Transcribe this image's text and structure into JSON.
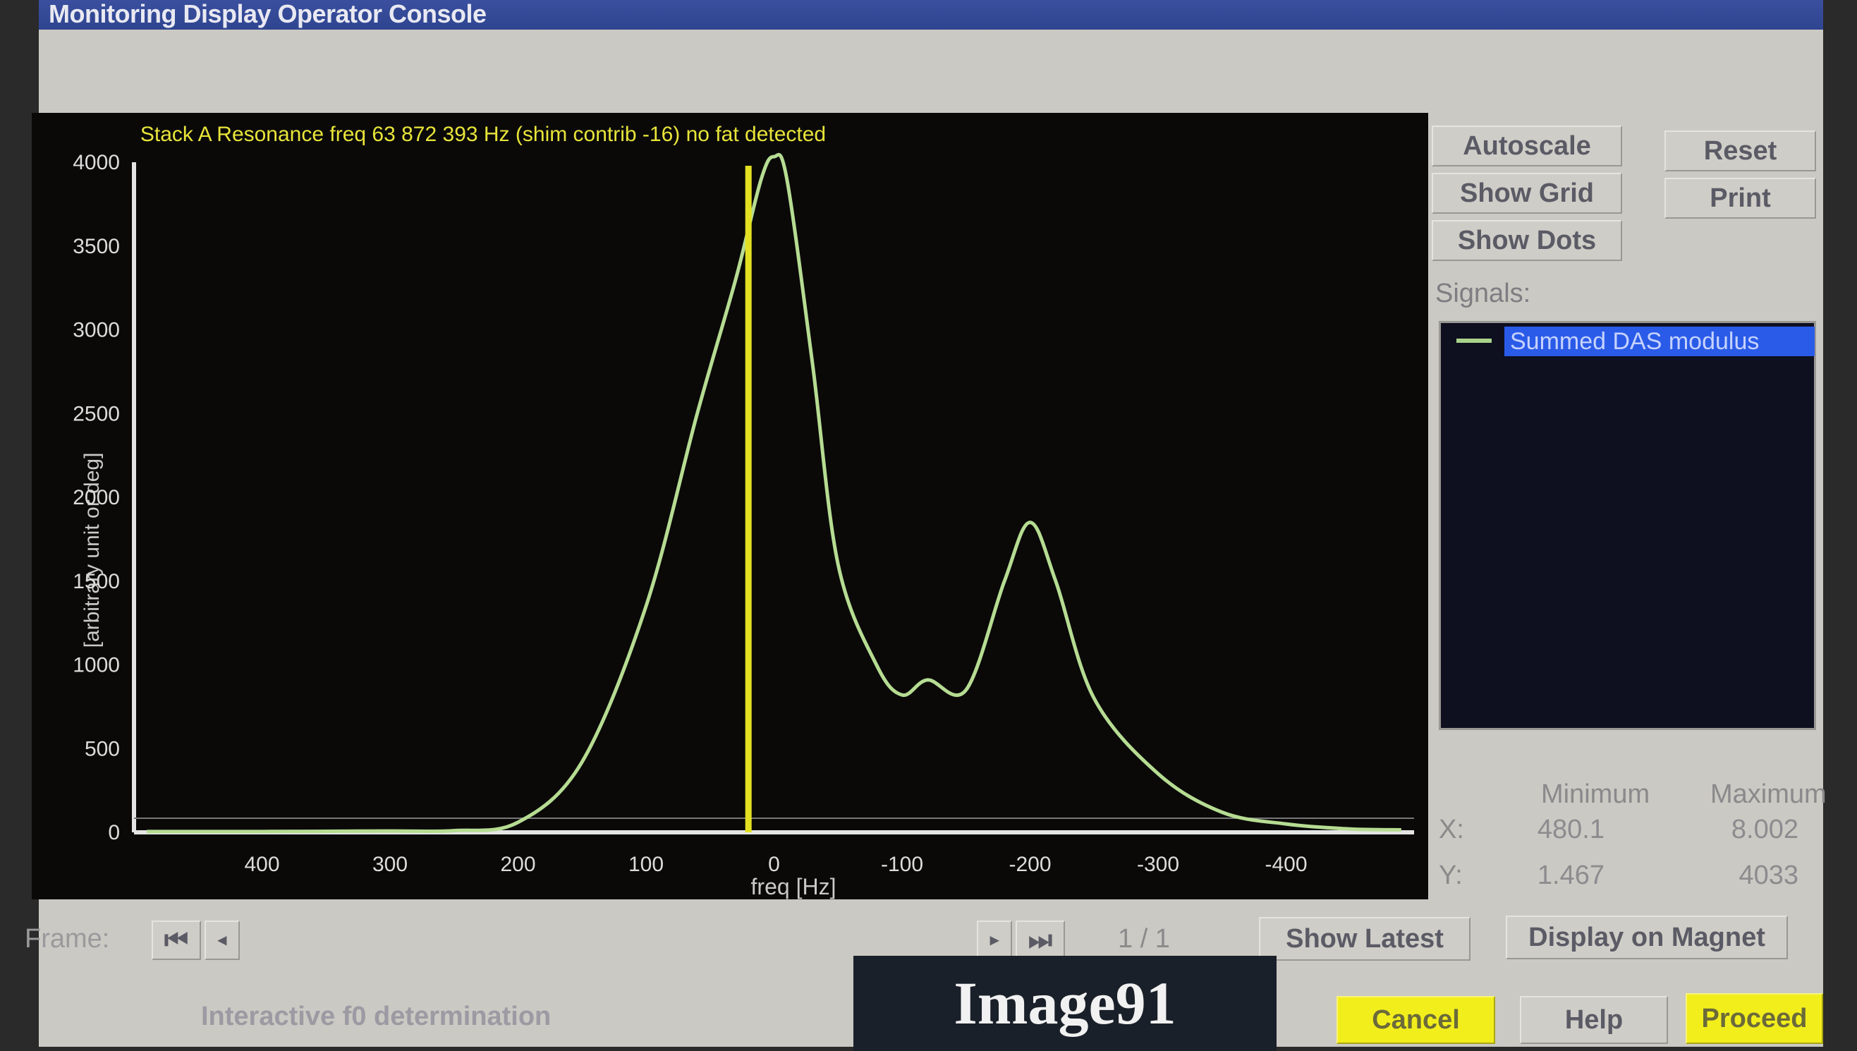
{
  "window": {
    "title": "Monitoring Display Operator Console"
  },
  "chart_data": {
    "type": "line",
    "title": "Stack A Resonance freq 63 872 393 Hz (shim contrib -16) no fat detected",
    "xlabel": "freq [Hz]",
    "ylabel": "[arbitrary unit or deg]",
    "xlim": [
      500,
      -500
    ],
    "ylim": [
      0,
      4000
    ],
    "x_ticks": [
      400,
      300,
      200,
      100,
      0,
      -100,
      -200,
      -300,
      -400
    ],
    "x_tick_labels": [
      "400",
      "300",
      "200",
      "100",
      "0",
      "-100",
      "-200",
      "-300",
      "-400"
    ],
    "y_ticks": [
      0,
      500,
      1000,
      1500,
      2000,
      2500,
      3000,
      3500,
      4000
    ],
    "y_tick_labels": [
      "0",
      "500",
      "1000",
      "1500",
      "2000",
      "2500",
      "3000",
      "3500",
      "4000"
    ],
    "marker_x": 20,
    "series": [
      {
        "name": "Summed DAS modulus",
        "color": "#b6dc92",
        "x": [
          490,
          400,
          300,
          250,
          200,
          150,
          100,
          60,
          30,
          10,
          0,
          -10,
          -30,
          -50,
          -80,
          -100,
          -120,
          -150,
          -180,
          -200,
          -220,
          -250,
          -300,
          -350,
          -400,
          -450,
          -490
        ],
        "y": [
          5,
          5,
          8,
          10,
          60,
          420,
          1350,
          2500,
          3300,
          3900,
          4033,
          3900,
          2800,
          1600,
          1000,
          820,
          910,
          850,
          1500,
          1850,
          1500,
          800,
          350,
          120,
          50,
          20,
          15
        ]
      }
    ]
  },
  "controls": {
    "autoscale": "Autoscale",
    "show_grid": "Show Grid",
    "show_dots": "Show Dots",
    "reset": "Reset",
    "print": "Print"
  },
  "signals": {
    "label": "Signals:",
    "items": [
      "Summed DAS modulus"
    ],
    "swatch_color": "#a9d38a"
  },
  "stats": {
    "minimum_label": "Minimum",
    "maximum_label": "Maximum",
    "x_label": "X:",
    "y_label": "Y:",
    "x_min": "480.1",
    "x_max": "8.002",
    "y_min": "1.467",
    "y_max": "4033"
  },
  "frame": {
    "label": "Frame:",
    "first_icon": "skip-back-icon",
    "prev_icon": "step-back-icon",
    "next_icon": "step-forward-icon",
    "last_icon": "skip-forward-icon",
    "counter": "1 / 1",
    "show_latest": "Show Latest",
    "display_on_magnet": "Display on Magnet"
  },
  "footer": {
    "status": "Interactive f0 determination",
    "image_label": "Image91",
    "cancel": "Cancel",
    "help": "Help",
    "proceed": "Proceed"
  }
}
